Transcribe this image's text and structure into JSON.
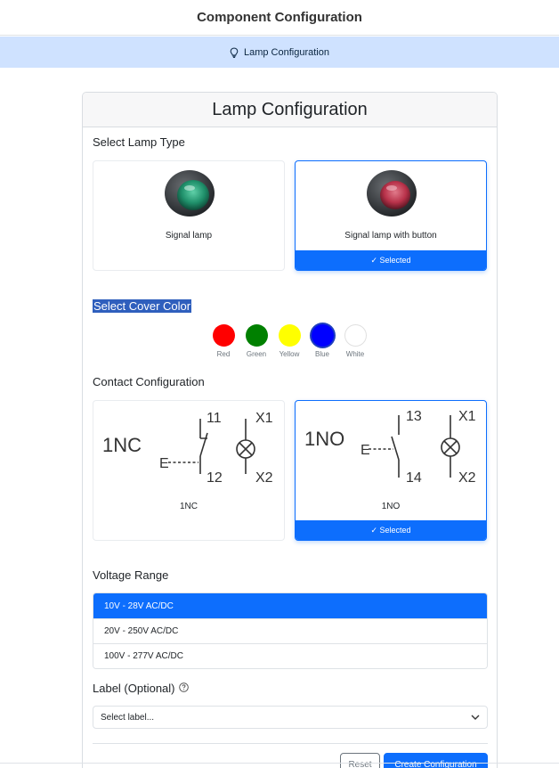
{
  "app": {
    "title": "Component Configuration"
  },
  "tab": {
    "label": "Lamp Configuration",
    "icon": "lightbulb-icon"
  },
  "card": {
    "title": "Lamp Configuration"
  },
  "lamp_type": {
    "label": "Select Lamp Type",
    "options": [
      {
        "label": "Signal lamp",
        "color": "#1f8f6a",
        "selected": false
      },
      {
        "label": "Signal lamp with button",
        "color": "#b8324a",
        "selected": true
      }
    ],
    "selected_badge": "✓ Selected"
  },
  "cover_color": {
    "label": "Select Cover Color",
    "options": [
      {
        "label": "Red",
        "color": "#ff0000"
      },
      {
        "label": "Green",
        "color": "#008000"
      },
      {
        "label": "Yellow",
        "color": "#ffff00"
      },
      {
        "label": "Blue",
        "color": "#0000ff",
        "selected": true
      },
      {
        "label": "White",
        "color": "#ffffff"
      }
    ]
  },
  "contact": {
    "label": "Contact Configuration",
    "options": [
      {
        "label": "1NC",
        "code": "1NC",
        "top_terminal": "11",
        "bottom_terminal": "12",
        "lamp_top": "X1",
        "lamp_bottom": "X2",
        "actuator": "E",
        "selected": false
      },
      {
        "label": "1NO",
        "code": "1NO",
        "top_terminal": "13",
        "bottom_terminal": "14",
        "lamp_top": "X1",
        "lamp_bottom": "X2",
        "actuator": "E",
        "selected": true
      }
    ],
    "selected_badge": "✓ Selected"
  },
  "voltage": {
    "label": "Voltage Range",
    "options": [
      "10V - 28V AC/DC",
      "20V - 250V AC/DC",
      "100V - 277V AC/DC"
    ],
    "selected_index": 0
  },
  "label_field": {
    "label": "Label (Optional)",
    "help_icon": "question-circle-icon",
    "placeholder": "Select label..."
  },
  "buttons": {
    "reset": "Reset",
    "create": "Create Configuration"
  },
  "colors": {
    "accent": "#0d6efd",
    "tabbar": "#cfe2ff",
    "highlight": "#2f5fbd"
  }
}
